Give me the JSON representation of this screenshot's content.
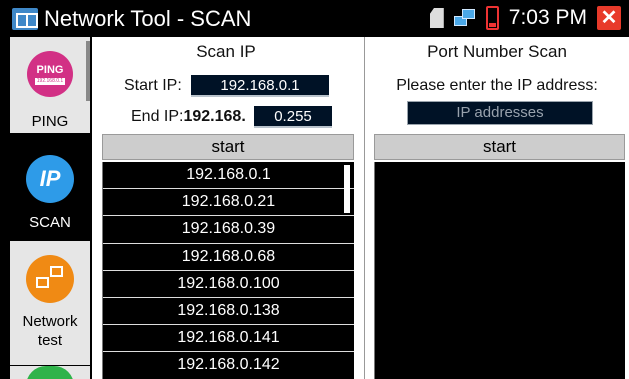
{
  "titlebar": {
    "title": "Network Tool - SCAN",
    "time": "7:03 PM"
  },
  "sidebar": {
    "items": [
      {
        "label": "PING",
        "icon_text": "PING",
        "icon_sub": "192.168.0.1"
      },
      {
        "label": "SCAN",
        "icon_text": "IP"
      },
      {
        "label_line1": "Network",
        "label_line2": "test"
      }
    ]
  },
  "scan_ip": {
    "title": "Scan IP",
    "start_label": "Start IP:",
    "start_value": "192.168.0.1",
    "end_label": "End IP:",
    "end_prefix": "192.168.",
    "end_value": "0.255",
    "start_button": "start",
    "results": [
      "192.168.0.1",
      "192.168.0.21",
      "192.168.0.39",
      "192.168.0.68",
      "192.168.0.100",
      "192.168.0.138",
      "192.168.0.141",
      "192.168.0.142"
    ]
  },
  "port_scan": {
    "title": "Port Number Scan",
    "prompt": "Please enter the IP address:",
    "placeholder": "IP addresses",
    "start_button": "start"
  },
  "colors": {
    "accent_blue": "#2e9be8",
    "ping_pink": "#d23085",
    "network_orange": "#f08a14",
    "close_red": "#e83a2a"
  }
}
